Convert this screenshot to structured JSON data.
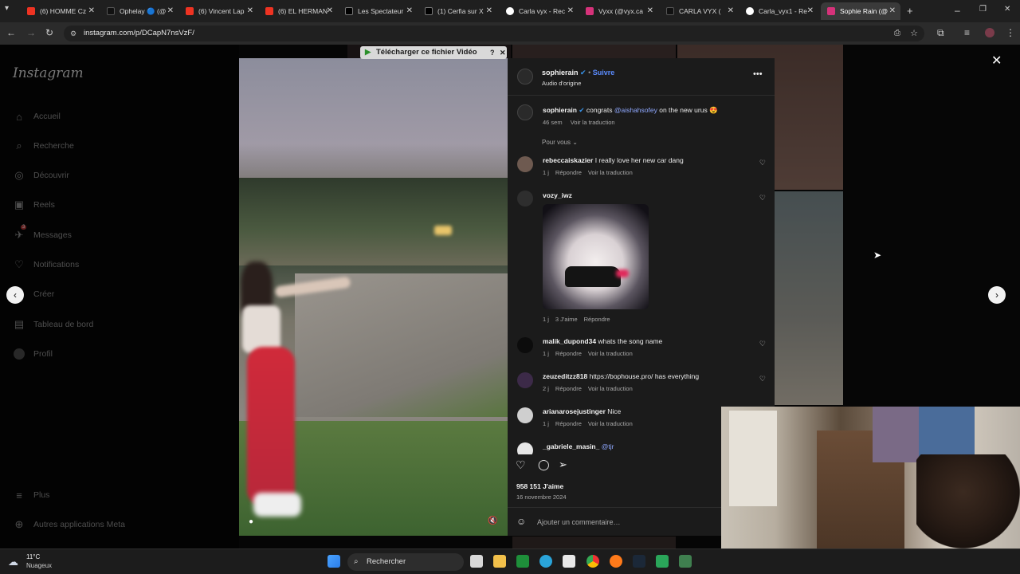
{
  "browser": {
    "tabs": [
      {
        "label": "(6) HOMME Cz",
        "icon": "youtube-icon"
      },
      {
        "label": "Ophelay 🔵 (@",
        "icon": "tiktok-icon"
      },
      {
        "label": "(6) Vincent Lap",
        "icon": "youtube-icon"
      },
      {
        "label": "(6) EL HERMAN",
        "icon": "youtube-icon"
      },
      {
        "label": "Les Spectateur",
        "icon": "x-icon"
      },
      {
        "label": "(1) Cerfia sur X",
        "icon": "x-icon"
      },
      {
        "label": "Carla vyx - Rec",
        "icon": "google-icon"
      },
      {
        "label": "Vyxx (@vyx.ca",
        "icon": "instagram-icon"
      },
      {
        "label": "CARLA VYX (",
        "icon": "tiktok-icon"
      },
      {
        "label": "Carla_vyx1 - Re",
        "icon": "google-icon"
      },
      {
        "label": "Sophie Rain (@",
        "icon": "instagram-icon"
      }
    ],
    "new_tab": "+",
    "url": "instagram.com/p/DCapN7nsVzF/"
  },
  "instagram": {
    "logo": "Instagram",
    "nav": [
      {
        "label": "Accueil",
        "icon": "home-icon"
      },
      {
        "label": "Recherche",
        "icon": "search-icon"
      },
      {
        "label": "Découvrir",
        "icon": "compass-icon"
      },
      {
        "label": "Reels",
        "icon": "reels-icon"
      },
      {
        "label": "Messages",
        "icon": "messenger-icon",
        "badge": "3"
      },
      {
        "label": "Notifications",
        "icon": "heart-icon"
      },
      {
        "label": "Créer",
        "icon": "plus-icon"
      },
      {
        "label": "Tableau de bord",
        "icon": "dashboard-icon"
      },
      {
        "label": "Profil",
        "icon": "profile-icon"
      }
    ],
    "more": "Plus",
    "meta_apps": "Autres applications Meta"
  },
  "download_bar": {
    "label": "Télécharger ce fichier Vidéo",
    "help": "?"
  },
  "post": {
    "author": "sophierain",
    "verified": true,
    "follow": "Suivre",
    "audio": "Audio d'origine",
    "caption_user": "sophierain",
    "caption_text": "congrats",
    "caption_mention": "@aishahsofey",
    "caption_rest": "on the new urus 😍",
    "caption_time": "46 sem",
    "see_translation": "Voir la traduction",
    "filter": "Pour vous",
    "likes": "958 151 J'aime",
    "date": "16 novembre 2024",
    "add_comment": "Ajouter un commentaire…"
  },
  "comments": [
    {
      "user": "rebeccaiskazier",
      "text": "I really love her new car dang",
      "time": "1 j",
      "reply": "Répondre",
      "translate": "Voir la traduction"
    },
    {
      "user": "vozy_iwz",
      "text": "",
      "time": "1 j",
      "likes": "3 J'aime",
      "reply": "Répondre",
      "has_image": true
    },
    {
      "user": "malik_dupond34",
      "text": "whats the song name",
      "time": "1 j",
      "reply": "Répondre",
      "translate": "Voir la traduction"
    },
    {
      "user": "zeuzeditzz818",
      "text": "https://bophouse.pro/ has everything",
      "time": "2 j",
      "reply": "Répondre",
      "translate": "Voir la traduction"
    },
    {
      "user": "arianarosejustinger",
      "text": "Nice",
      "time": "1 j",
      "reply": "Répondre",
      "translate": "Voir la traduction"
    },
    {
      "user": "_gabriele_masin_",
      "text": "@tjr",
      "time": "",
      "reply": "",
      "translate": ""
    }
  ],
  "taskbar": {
    "weather_temp": "11°C",
    "weather_desc": "Nuageux",
    "search_placeholder": "Rechercher"
  },
  "colors": {
    "accent": "#5b8cff",
    "panel": "#1b1b1b"
  }
}
